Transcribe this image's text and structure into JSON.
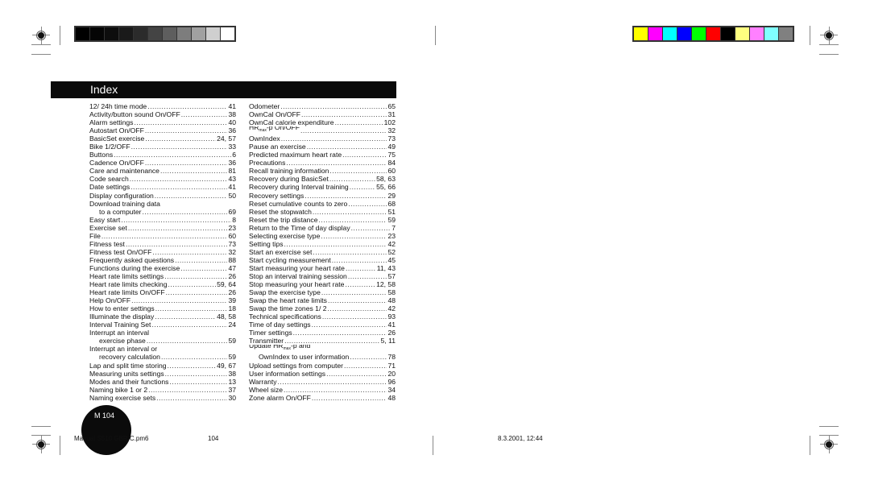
{
  "header": {
    "title": "Index"
  },
  "print_marks": {
    "gray_swatches": [
      "#000000",
      "#050505",
      "#0d0d0d",
      "#1a1a1a",
      "#2b2b2b",
      "#444444",
      "#5e5e5e",
      "#7d7d7d",
      "#a1a1a1",
      "#cfcfcf",
      "#ffffff"
    ],
    "color_swatches": [
      "#ffff00",
      "#ff00ff",
      "#00ffff",
      "#0000ff",
      "#00ff00",
      "#ff0000",
      "#000000",
      "#ffff80",
      "#ff80ff",
      "#80ffff",
      "#808080"
    ]
  },
  "index": {
    "left": [
      {
        "term": "12/ 24h time mode",
        "page": "41"
      },
      {
        "term": "Activity/button sound On/OFF",
        "page": "38"
      },
      {
        "term": "Alarm settings",
        "page": "40"
      },
      {
        "term": "Autostart On/OFF",
        "page": "36"
      },
      {
        "term": "BasicSet exercise",
        "page": "24, 57"
      },
      {
        "term": "Bike 1/2/OFF",
        "page": "33"
      },
      {
        "term": "Buttons",
        "page": "6"
      },
      {
        "term": "Cadence On/OFF",
        "page": "36"
      },
      {
        "term": "Care and maintenance",
        "page": "81"
      },
      {
        "term": "Code search",
        "page": "43"
      },
      {
        "term": "Date settings",
        "page": "41"
      },
      {
        "term": "Display configuration",
        "page": "50"
      },
      {
        "term": "Download training data",
        "page": ""
      },
      {
        "term": "to a computer",
        "page": "69"
      },
      {
        "term": "Easy start",
        "page": "8"
      },
      {
        "term": "Exercise set",
        "page": "23"
      },
      {
        "term": "File",
        "page": "60"
      },
      {
        "term": "Fitness test",
        "page": "73"
      },
      {
        "term": "Fitness test On/OFF",
        "page": "32"
      },
      {
        "term": "Frequently asked questions",
        "page": "88"
      },
      {
        "term": "Functions during the exercise",
        "page": "47"
      },
      {
        "term": "Heart rate limits settings",
        "page": "26"
      },
      {
        "term": "Heart rate limits checking",
        "page": "59, 64"
      },
      {
        "term": "Heart rate limits On/OFF",
        "page": "26"
      },
      {
        "term": "Help On/OFF",
        "page": "39"
      },
      {
        "term": "How to enter settings",
        "page": "18"
      },
      {
        "term": "Illuminate the display",
        "page": "48, 58"
      },
      {
        "term": "Interval Training Set",
        "page": "24"
      },
      {
        "term": "Interrupt an interval",
        "page": ""
      },
      {
        "term": "exercise phase",
        "page": "59"
      },
      {
        "term": "Interrupt an interval or",
        "page": ""
      },
      {
        "term": "recovery calculation",
        "page": "59"
      },
      {
        "term": "Lap and split time storing",
        "page": "49, 67"
      },
      {
        "term": "Measuring units settings",
        "page": "38"
      },
      {
        "term": "Modes and their functions",
        "page": "13"
      },
      {
        "term": "Naming bike 1 or 2",
        "page": "37"
      },
      {
        "term": "Naming exercise sets",
        "page": "30"
      }
    ],
    "right": [
      {
        "term": "Odometer",
        "page": "65"
      },
      {
        "term": "OwnCal On/OFF",
        "page": "31"
      },
      {
        "term": "OwnCal calorie expenditure",
        "page": "102"
      },
      {
        "term": "HR",
        "sub": "max",
        "term_after": "-p On/OFF",
        "page": "32"
      },
      {
        "term": "OwnIndex",
        "page": "73"
      },
      {
        "term": "Pause an exercise",
        "page": "49"
      },
      {
        "term": "Predicted maximum heart rate",
        "page": "75"
      },
      {
        "term": "Precautions",
        "page": "84"
      },
      {
        "term": "Recall training information",
        "page": "60"
      },
      {
        "term": "Recovery during BasicSet",
        "page": "58, 63"
      },
      {
        "term": "Recovery during Interval training",
        "page": "55, 66"
      },
      {
        "term": "Recovery settings",
        "page": "29"
      },
      {
        "term": "Reset cumulative counts to zero",
        "page": "68"
      },
      {
        "term": "Reset the stopwatch",
        "page": "51"
      },
      {
        "term": "Reset the trip distance",
        "page": "59"
      },
      {
        "term": "Return to the Time of day display",
        "page": "7"
      },
      {
        "term": "Selecting exercise type",
        "page": "23"
      },
      {
        "term": "Setting tips",
        "page": "42"
      },
      {
        "term": "Start an exercise set",
        "page": "52"
      },
      {
        "term": "Start cycling measurement",
        "page": "45"
      },
      {
        "term": "Start measuring your heart rate",
        "page": "11, 43"
      },
      {
        "term": "Stop an interval training session",
        "page": "57"
      },
      {
        "term": "Stop measuring your heart rate",
        "page": "12, 58"
      },
      {
        "term": "Swap the exercise type",
        "page": "58"
      },
      {
        "term": "Swap the heart rate limits",
        "page": "48"
      },
      {
        "term": "Swap the time zones 1/ 2",
        "page": "42"
      },
      {
        "term": "Technical specifications",
        "page": "93"
      },
      {
        "term": "Time of day settings",
        "page": "41"
      },
      {
        "term": "Timer settings",
        "page": "26"
      },
      {
        "term": "Transmitter",
        "page": "5, 11"
      },
      {
        "term": "Update HR",
        "sub": "max",
        "term_after": "-p and",
        "page": ""
      },
      {
        "term": "OwnIndex to user information",
        "page": "78"
      },
      {
        "term": "Upload settings from computer",
        "page": "71"
      },
      {
        "term": "User information settings",
        "page": "20"
      },
      {
        "term": "Warranty",
        "page": "96"
      },
      {
        "term": "Wheel size",
        "page": "34"
      },
      {
        "term": "Zone alarm On/OFF",
        "page": "48"
      }
    ]
  },
  "footer": {
    "circle_label": "M 104",
    "file_name": "Manual S510 GBR C.pm6",
    "page_number": "104",
    "datetime": "8.3.2001, 12:44"
  }
}
